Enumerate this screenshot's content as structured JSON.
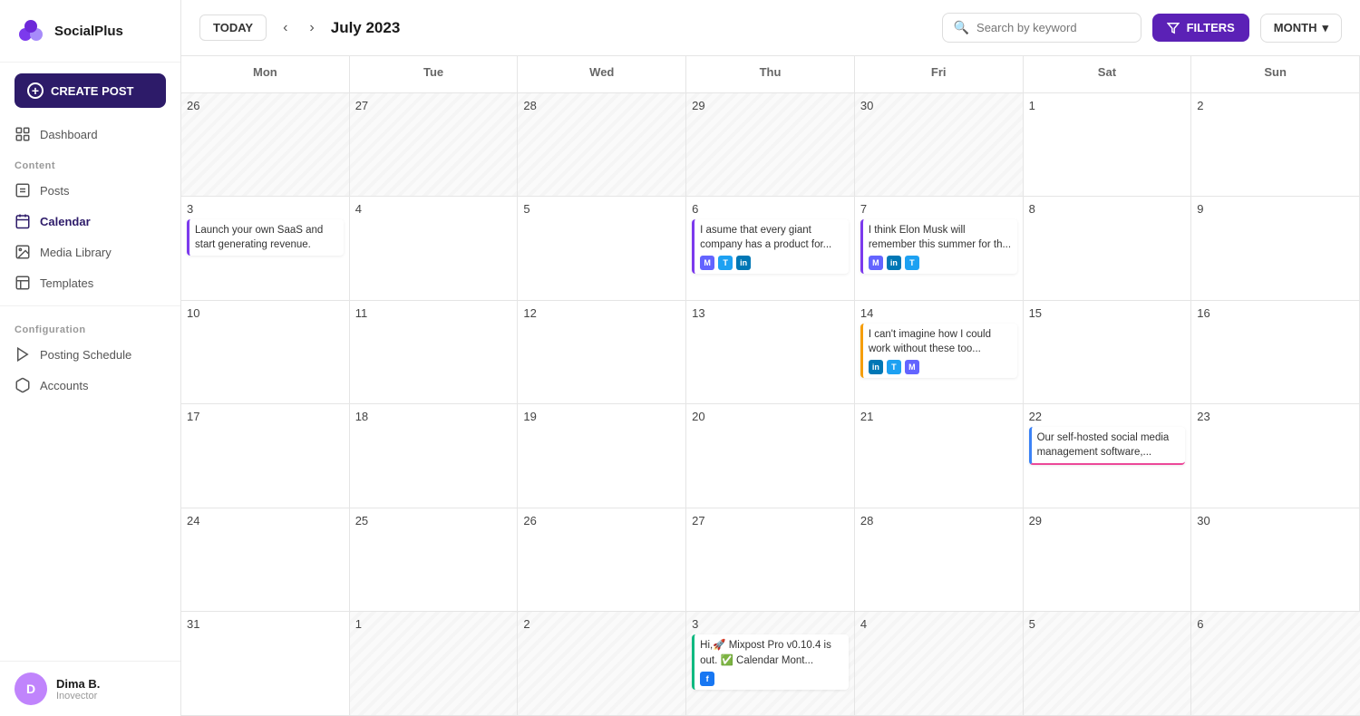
{
  "logo": {
    "text": "SocialPlus"
  },
  "sidebar": {
    "create_btn": "CREATE POST",
    "sections": [
      {
        "items": [
          {
            "id": "dashboard",
            "label": "Dashboard",
            "icon": "dashboard"
          }
        ]
      },
      {
        "label": "Content",
        "items": [
          {
            "id": "posts",
            "label": "Posts",
            "icon": "posts"
          },
          {
            "id": "calendar",
            "label": "Calendar",
            "icon": "calendar",
            "active": true
          },
          {
            "id": "media-library",
            "label": "Media Library",
            "icon": "media"
          },
          {
            "id": "templates",
            "label": "Templates",
            "icon": "templates"
          }
        ]
      },
      {
        "label": "Configuration",
        "items": [
          {
            "id": "posting-schedule",
            "label": "Posting Schedule",
            "icon": "schedule"
          },
          {
            "id": "accounts",
            "label": "Accounts",
            "icon": "accounts"
          }
        ]
      }
    ],
    "user": {
      "initials": "D",
      "name": "Dima B.",
      "role": "Inovector"
    }
  },
  "header": {
    "today_label": "TODAY",
    "month_label": "July 2023",
    "search_placeholder": "Search by keyword",
    "filters_label": "FILTERS",
    "month_btn_label": "MONTH"
  },
  "calendar": {
    "day_headers": [
      "Mon",
      "Tue",
      "Wed",
      "Thu",
      "Fri",
      "Sat",
      "Sun"
    ],
    "weeks": [
      {
        "days": [
          {
            "date": "26",
            "outside": true,
            "events": []
          },
          {
            "date": "27",
            "outside": true,
            "events": []
          },
          {
            "date": "28",
            "outside": true,
            "events": []
          },
          {
            "date": "29",
            "outside": true,
            "events": []
          },
          {
            "date": "30",
            "outside": true,
            "events": []
          },
          {
            "date": "1",
            "outside": false,
            "events": []
          },
          {
            "date": "2",
            "outside": false,
            "events": []
          }
        ]
      },
      {
        "days": [
          {
            "date": "3",
            "outside": false,
            "events": [
              {
                "type": "purple-left",
                "text": "Launch your own SaaS and start generating revenue.",
                "icons": []
              }
            ]
          },
          {
            "date": "4",
            "outside": false,
            "events": []
          },
          {
            "date": "5",
            "outside": false,
            "events": []
          },
          {
            "date": "6",
            "outside": false,
            "events": [
              {
                "type": "purple-left",
                "text": "I asume that every giant company has a product for...",
                "icons": [
                  "mastodon",
                  "twitter",
                  "linkedin"
                ]
              }
            ]
          },
          {
            "date": "7",
            "outside": false,
            "events": [
              {
                "type": "purple-left",
                "text": "I think Elon Musk will remember this summer for th...",
                "icons": [
                  "mastodon",
                  "linkedin",
                  "twitter"
                ]
              }
            ]
          },
          {
            "date": "8",
            "outside": false,
            "events": []
          },
          {
            "date": "9",
            "outside": false,
            "events": []
          }
        ]
      },
      {
        "days": [
          {
            "date": "10",
            "outside": false,
            "events": []
          },
          {
            "date": "11",
            "outside": false,
            "events": []
          },
          {
            "date": "12",
            "outside": false,
            "events": []
          },
          {
            "date": "13",
            "outside": false,
            "events": []
          },
          {
            "date": "14",
            "outside": false,
            "events": [
              {
                "type": "yellow-left",
                "text": "I can't imagine how I could work without these too...",
                "icons": [
                  "linkedin",
                  "twitter",
                  "mastodon"
                ]
              }
            ]
          },
          {
            "date": "15",
            "outside": false,
            "events": []
          },
          {
            "date": "16",
            "outside": false,
            "events": []
          }
        ]
      },
      {
        "days": [
          {
            "date": "17",
            "outside": false,
            "events": []
          },
          {
            "date": "18",
            "outside": false,
            "events": []
          },
          {
            "date": "19",
            "outside": false,
            "events": []
          },
          {
            "date": "20",
            "outside": false,
            "events": []
          },
          {
            "date": "21",
            "outside": false,
            "events": []
          },
          {
            "date": "22",
            "outside": false,
            "events": [
              {
                "type": "blue-left",
                "text": "Our self-hosted social media management software,...",
                "icons": [],
                "bottom_color": "pink"
              }
            ]
          },
          {
            "date": "23",
            "outside": false,
            "events": []
          }
        ]
      },
      {
        "days": [
          {
            "date": "24",
            "outside": false,
            "events": []
          },
          {
            "date": "25",
            "outside": false,
            "events": []
          },
          {
            "date": "26",
            "outside": false,
            "events": []
          },
          {
            "date": "27",
            "outside": false,
            "events": []
          },
          {
            "date": "28",
            "outside": false,
            "events": []
          },
          {
            "date": "29",
            "outside": false,
            "events": []
          },
          {
            "date": "30",
            "outside": false,
            "events": []
          }
        ]
      },
      {
        "days": [
          {
            "date": "31",
            "outside": false,
            "events": []
          },
          {
            "date": "1",
            "outside": true,
            "events": []
          },
          {
            "date": "2",
            "outside": true,
            "events": []
          },
          {
            "date": "3",
            "outside": true,
            "events": [
              {
                "type": "green-pink-left",
                "text": "Hi,🚀 Mixpost Pro v0.10.4 is out. ✅ Calendar Mont...",
                "icons": [
                  "facebook"
                ]
              }
            ]
          },
          {
            "date": "4",
            "outside": true,
            "events": []
          },
          {
            "date": "5",
            "outside": true,
            "events": []
          },
          {
            "date": "6",
            "outside": true,
            "events": []
          }
        ]
      }
    ]
  }
}
